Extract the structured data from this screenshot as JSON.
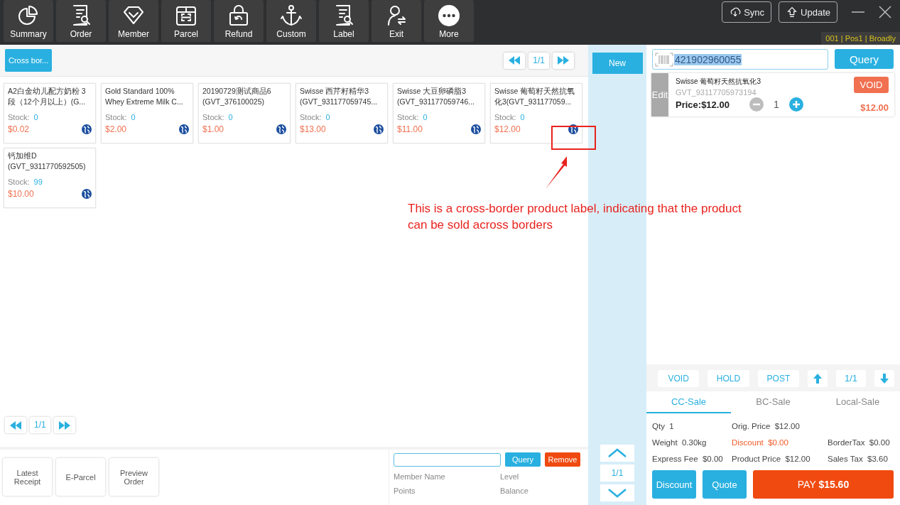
{
  "toolbar": [
    {
      "label": "Summary",
      "kind": "pie"
    },
    {
      "label": "Order",
      "kind": "search"
    },
    {
      "label": "Member",
      "kind": "diamond"
    },
    {
      "label": "Parcel",
      "kind": "box"
    },
    {
      "label": "Refund",
      "kind": "lock"
    },
    {
      "label": "Custom",
      "kind": "anchor"
    },
    {
      "label": "Label",
      "kind": "search"
    },
    {
      "label": "Exit",
      "kind": "person"
    },
    {
      "label": "More",
      "kind": "more"
    }
  ],
  "top_buttons": [
    {
      "label": "Sync",
      "kind": "sync"
    },
    {
      "label": "Update",
      "kind": "update"
    }
  ],
  "status": "001 | Pos1 | Broadly",
  "category_button": "Cross bor...",
  "top_pager": "1/1",
  "products": [
    {
      "name": "A2白金幼儿配方奶粉 3段（12个月以上）(G...",
      "stock_label": "Stock:",
      "stock": "0",
      "price": "$0.02",
      "cross_border": true
    },
    {
      "name": "Gold Standard 100% Whey Extreme Milk C...",
      "stock_label": "Stock:",
      "stock": "0",
      "price": "$2.00",
      "cross_border": true
    },
    {
      "name": "20190729测试商品6 (GVT_376100025)",
      "stock_label": "Stock:",
      "stock": "0",
      "price": "$1.00",
      "cross_border": true
    },
    {
      "name": "Swisse 西芹籽精华3 (GVT_931177059745...",
      "stock_label": "Stock:",
      "stock": "0",
      "price": "$13.00",
      "cross_border": true
    },
    {
      "name": "Swisse 大豆卵磷脂3 (GVT_931177059746...",
      "stock_label": "Stock:",
      "stock": "0",
      "price": "$11.00",
      "cross_border": true
    },
    {
      "name": "Swisse 葡萄籽天然抗氧化3(GVT_931177059...",
      "stock_label": "Stock:",
      "stock": "0",
      "price": "$12.00",
      "cross_border": true
    },
    {
      "name": "钙加维D (GVT_9311770592505)",
      "stock_label": "Stock:",
      "stock": "99",
      "price": "$10.00",
      "cross_border": true
    }
  ],
  "bottom_pager": "1/1",
  "footer_buttons": [
    "Latest\nReceipt",
    "E-Parcel",
    "Preview\nOrder"
  ],
  "member": {
    "query": "Query",
    "remove": "Remove",
    "fields": [
      "Member Name",
      "Level",
      "Points",
      "Balance"
    ]
  },
  "annotation": "This is a cross-border product label, indicating that the product\ncan be sold across borders",
  "new_button": "New",
  "side_pager": "1/1",
  "search": {
    "value": "421902960055",
    "button": "Query"
  },
  "cart": [
    {
      "edit": "Edit",
      "name": "Swisse 葡萄籽天然抗氧化3",
      "code": "GVT_93117705973194",
      "price": "Price:$12.00",
      "qty": "1",
      "void": "VOID",
      "total": "$12.00"
    }
  ],
  "cart_actions": [
    "VOID",
    "HOLD",
    "POST"
  ],
  "cart_pager": "1/1",
  "tabs": [
    {
      "label": "CC-Sale",
      "selected": true
    },
    {
      "label": "BC-Sale",
      "selected": false
    },
    {
      "label": "Local-Sale",
      "selected": false
    }
  ],
  "summary": [
    [
      {
        "label": "Qty",
        "value": "1",
        "highlight": false
      },
      {
        "label": "Orig. Price",
        "value": "$12.00",
        "highlight": false
      }
    ],
    [
      {
        "label": "Weight",
        "value": "0.30kg",
        "highlight": false
      },
      {
        "label": "Discount",
        "value": "$0.00",
        "highlight": true
      },
      {
        "label": "BorderTax",
        "value": "$0.00",
        "highlight": false
      }
    ],
    [
      {
        "label": "Express Fee",
        "value": "$0.00",
        "highlight": false
      },
      {
        "label": "Product Price",
        "value": "$12.00",
        "highlight": false
      },
      {
        "label": "Sales Tax",
        "value": "$3.60",
        "highlight": false
      }
    ]
  ],
  "bottom_buttons": [
    "Discount",
    "Quote"
  ],
  "pay": "PAY **$15.60**"
}
